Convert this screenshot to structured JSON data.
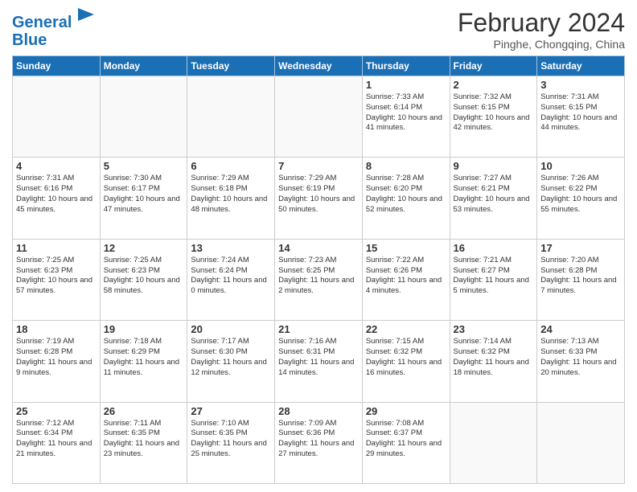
{
  "header": {
    "logo_line1": "General",
    "logo_line2": "Blue",
    "main_title": "February 2024",
    "subtitle": "Pinghe, Chongqing, China"
  },
  "days_of_week": [
    "Sunday",
    "Monday",
    "Tuesday",
    "Wednesday",
    "Thursday",
    "Friday",
    "Saturday"
  ],
  "weeks": [
    [
      {
        "day": "",
        "info": ""
      },
      {
        "day": "",
        "info": ""
      },
      {
        "day": "",
        "info": ""
      },
      {
        "day": "",
        "info": ""
      },
      {
        "day": "1",
        "info": "Sunrise: 7:33 AM\nSunset: 6:14 PM\nDaylight: 10 hours and 41 minutes."
      },
      {
        "day": "2",
        "info": "Sunrise: 7:32 AM\nSunset: 6:15 PM\nDaylight: 10 hours and 42 minutes."
      },
      {
        "day": "3",
        "info": "Sunrise: 7:31 AM\nSunset: 6:15 PM\nDaylight: 10 hours and 44 minutes."
      }
    ],
    [
      {
        "day": "4",
        "info": "Sunrise: 7:31 AM\nSunset: 6:16 PM\nDaylight: 10 hours and 45 minutes."
      },
      {
        "day": "5",
        "info": "Sunrise: 7:30 AM\nSunset: 6:17 PM\nDaylight: 10 hours and 47 minutes."
      },
      {
        "day": "6",
        "info": "Sunrise: 7:29 AM\nSunset: 6:18 PM\nDaylight: 10 hours and 48 minutes."
      },
      {
        "day": "7",
        "info": "Sunrise: 7:29 AM\nSunset: 6:19 PM\nDaylight: 10 hours and 50 minutes."
      },
      {
        "day": "8",
        "info": "Sunrise: 7:28 AM\nSunset: 6:20 PM\nDaylight: 10 hours and 52 minutes."
      },
      {
        "day": "9",
        "info": "Sunrise: 7:27 AM\nSunset: 6:21 PM\nDaylight: 10 hours and 53 minutes."
      },
      {
        "day": "10",
        "info": "Sunrise: 7:26 AM\nSunset: 6:22 PM\nDaylight: 10 hours and 55 minutes."
      }
    ],
    [
      {
        "day": "11",
        "info": "Sunrise: 7:25 AM\nSunset: 6:23 PM\nDaylight: 10 hours and 57 minutes."
      },
      {
        "day": "12",
        "info": "Sunrise: 7:25 AM\nSunset: 6:23 PM\nDaylight: 10 hours and 58 minutes."
      },
      {
        "day": "13",
        "info": "Sunrise: 7:24 AM\nSunset: 6:24 PM\nDaylight: 11 hours and 0 minutes."
      },
      {
        "day": "14",
        "info": "Sunrise: 7:23 AM\nSunset: 6:25 PM\nDaylight: 11 hours and 2 minutes."
      },
      {
        "day": "15",
        "info": "Sunrise: 7:22 AM\nSunset: 6:26 PM\nDaylight: 11 hours and 4 minutes."
      },
      {
        "day": "16",
        "info": "Sunrise: 7:21 AM\nSunset: 6:27 PM\nDaylight: 11 hours and 5 minutes."
      },
      {
        "day": "17",
        "info": "Sunrise: 7:20 AM\nSunset: 6:28 PM\nDaylight: 11 hours and 7 minutes."
      }
    ],
    [
      {
        "day": "18",
        "info": "Sunrise: 7:19 AM\nSunset: 6:28 PM\nDaylight: 11 hours and 9 minutes."
      },
      {
        "day": "19",
        "info": "Sunrise: 7:18 AM\nSunset: 6:29 PM\nDaylight: 11 hours and 11 minutes."
      },
      {
        "day": "20",
        "info": "Sunrise: 7:17 AM\nSunset: 6:30 PM\nDaylight: 11 hours and 12 minutes."
      },
      {
        "day": "21",
        "info": "Sunrise: 7:16 AM\nSunset: 6:31 PM\nDaylight: 11 hours and 14 minutes."
      },
      {
        "day": "22",
        "info": "Sunrise: 7:15 AM\nSunset: 6:32 PM\nDaylight: 11 hours and 16 minutes."
      },
      {
        "day": "23",
        "info": "Sunrise: 7:14 AM\nSunset: 6:32 PM\nDaylight: 11 hours and 18 minutes."
      },
      {
        "day": "24",
        "info": "Sunrise: 7:13 AM\nSunset: 6:33 PM\nDaylight: 11 hours and 20 minutes."
      }
    ],
    [
      {
        "day": "25",
        "info": "Sunrise: 7:12 AM\nSunset: 6:34 PM\nDaylight: 11 hours and 21 minutes."
      },
      {
        "day": "26",
        "info": "Sunrise: 7:11 AM\nSunset: 6:35 PM\nDaylight: 11 hours and 23 minutes."
      },
      {
        "day": "27",
        "info": "Sunrise: 7:10 AM\nSunset: 6:35 PM\nDaylight: 11 hours and 25 minutes."
      },
      {
        "day": "28",
        "info": "Sunrise: 7:09 AM\nSunset: 6:36 PM\nDaylight: 11 hours and 27 minutes."
      },
      {
        "day": "29",
        "info": "Sunrise: 7:08 AM\nSunset: 6:37 PM\nDaylight: 11 hours and 29 minutes."
      },
      {
        "day": "",
        "info": ""
      },
      {
        "day": "",
        "info": ""
      }
    ]
  ]
}
